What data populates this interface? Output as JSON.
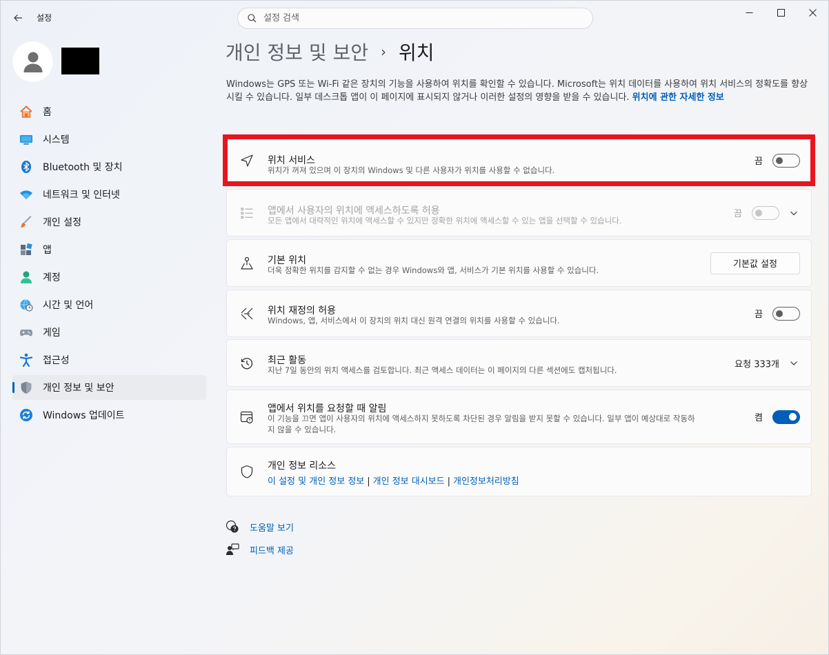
{
  "app": {
    "title": "설정"
  },
  "search": {
    "placeholder": "설정 검색"
  },
  "sidebar": {
    "items": [
      {
        "label": "홈"
      },
      {
        "label": "시스템"
      },
      {
        "label": "Bluetooth 및 장치"
      },
      {
        "label": "네트워크 및 인터넷"
      },
      {
        "label": "개인 설정"
      },
      {
        "label": "앱"
      },
      {
        "label": "계정"
      },
      {
        "label": "시간 및 언어"
      },
      {
        "label": "게임"
      },
      {
        "label": "접근성"
      },
      {
        "label": "개인 정보 및 보안"
      },
      {
        "label": "Windows 업데이트"
      }
    ]
  },
  "header": {
    "breadcrumb_parent": "개인 정보 및 보안",
    "separator": "›",
    "current": "위치"
  },
  "description": {
    "text": "Windows는 GPS 또는 Wi-Fi 같은 장치의 기능을 사용하여 위치를 확인할 수 있습니다. Microsoft는 위치 데이터를 사용하여 위치 서비스의 정확도를 향상시킬 수 있습니다. 일부 데스크톱 앱이 이 페이지에 표시되지 않거나 이러한 설정의 영향을 받을 수 있습니다. ",
    "link": "위치에 관한 자세한 정보"
  },
  "cards": {
    "location_service": {
      "title": "위치 서비스",
      "sub": "위치가 꺼져 있으며 이 장치의 Windows 및 다른 사용자가 위치를 사용할 수 없습니다.",
      "state": "끔"
    },
    "app_access": {
      "title": "앱에서 사용자의 위치에 액세스하도록 허용",
      "sub": "모든 앱에서 대략적인 위치에 액세스할 수 있지만 정확한 위치에 액세스할 수 있는 앱을 선택할 수 있습니다.",
      "state": "끔"
    },
    "default_location": {
      "title": "기본 위치",
      "sub": "더욱 정확한 위치를 감지할 수 없는 경우 Windows와 앱, 서비스가 기본 위치를 사용할 수 있습니다.",
      "button": "기본값 설정"
    },
    "override": {
      "title": "위치 재정의 허용",
      "sub": "Windows, 앱, 서비스에서 이 장치의 위치 대신 원격 연결의 위치를 사용할 수 있습니다.",
      "state": "끔"
    },
    "recent": {
      "title": "최근 활동",
      "sub": "지난 7일 동안의 위치 액세스를 검토합니다. 최근 액세스 데이터는 이 페이지의 다른 섹션에도 캡처됩니다.",
      "count": "요청 333개"
    },
    "notify": {
      "title": "앱에서 위치를 요청할 때 알림",
      "sub": "이 기능을 끄면 앱이 사용자의 위치에 액세스하지 못하도록 차단된 경우 알림을 받지 못할 수 있습니다. 일부 앱이 예상대로 작동하지 않을 수 있습니다.",
      "state": "켬"
    },
    "privacy": {
      "title": "개인 정보 리소스",
      "links": [
        "이 설정 및 개인 정보 정보",
        "개인 정보 대시보드",
        "개인정보처리방침"
      ],
      "separator": "|"
    }
  },
  "footer": {
    "help": "도움말 보기",
    "feedback": "피드백 제공"
  },
  "colors": {
    "accent": "#005fb8",
    "highlight": "#e8141e"
  }
}
